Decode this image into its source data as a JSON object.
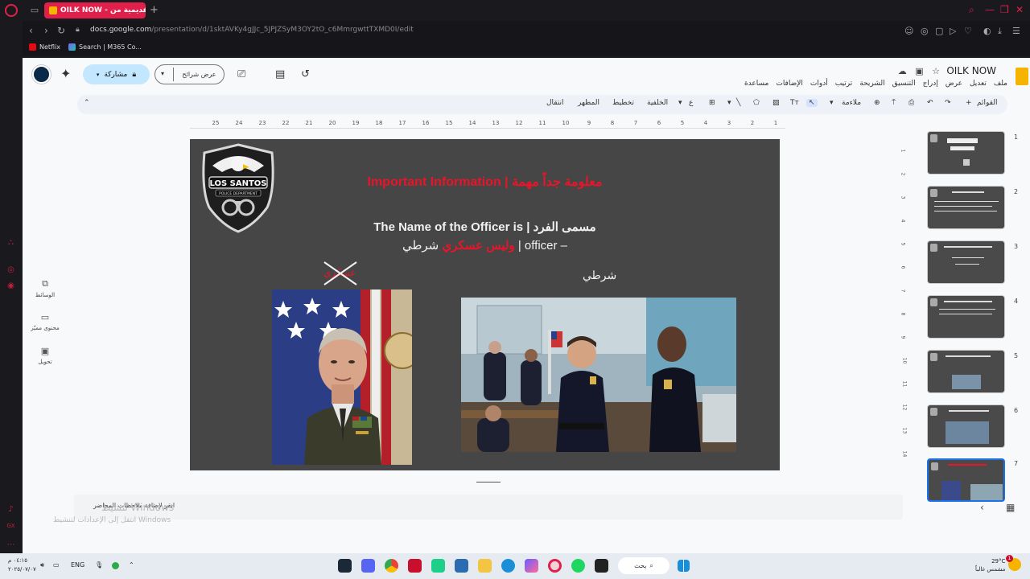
{
  "browser": {
    "tab_title": "OILK NOW - العروض التقديمية من",
    "url_host": "docs.google.com",
    "url_path": "/presentation/d/1sktAVKy4gJJc_5JPJZSyM3OY2tO_c6MmrgwttTXMD0I/edit",
    "bookmarks": [
      "Netflix",
      "Search | M365 Co..."
    ]
  },
  "docs": {
    "title": "OILK NOW",
    "menu": [
      "ملف",
      "تعديل",
      "عرض",
      "إدراج",
      "التنسيق",
      "الشريحة",
      "ترتيب",
      "أدوات",
      "الإضافات",
      "مساعدة"
    ],
    "share_label": "مشاركة",
    "present_label": "عرض شرائح",
    "toolbar": {
      "menus": "القوائم",
      "fit": "ملاءمة",
      "background": "الخلفية",
      "layout": "تخطيط",
      "theme": "المظهر",
      "transition": "انتقال"
    },
    "left_panel": [
      "الوسائط",
      "محتوى مميّز",
      "تحويل"
    ],
    "notes_placeholder": "انقر لإضافة ملاحظات المحاضر",
    "ruler_ticks": [
      "25",
      "24",
      "23",
      "22",
      "21",
      "20",
      "19",
      "18",
      "17",
      "16",
      "15",
      "14",
      "13",
      "12",
      "11",
      "10",
      "9",
      "8",
      "7",
      "6",
      "5",
      "4",
      "3",
      "2",
      "1"
    ],
    "vruler_ticks": [
      "1",
      "2",
      "3",
      "4",
      "5",
      "6",
      "7",
      "8",
      "9",
      "10",
      "11",
      "12",
      "13",
      "14"
    ],
    "slide_numbers": [
      "1",
      "2",
      "3",
      "4",
      "5",
      "6",
      "7"
    ]
  },
  "slide": {
    "badge_text": "LOS SANTOS",
    "badge_sub": "POLICE DEPARTMENT",
    "red_title": "Important Information | معلومة جداً مهمة",
    "name_line": "The Name of the Officer is | مسمى الفرد",
    "officer_prefix": "شرطي | officer –",
    "officer_red": "وليس عسكري",
    "crossed_word": "عسكري",
    "label_right": "شرطي"
  },
  "watermark": {
    "line1": "تنشيط Windows",
    "line2": "انتقل إلى الإعدادات لتنشيط Windows"
  },
  "taskbar": {
    "time": "٠٤:١٥ م",
    "date": "٢٠٢٥/٠٧/٠٧",
    "lang": "ENG",
    "search_label": "بحث",
    "weather_temp": "29°C",
    "weather_desc": "مشمس غالباً",
    "notif_count": "1"
  },
  "colors": {
    "accent_red": "#e8152a",
    "opera_red": "#e0204a",
    "share_blue": "#c2e7ff",
    "slide_bg": "#464646"
  }
}
